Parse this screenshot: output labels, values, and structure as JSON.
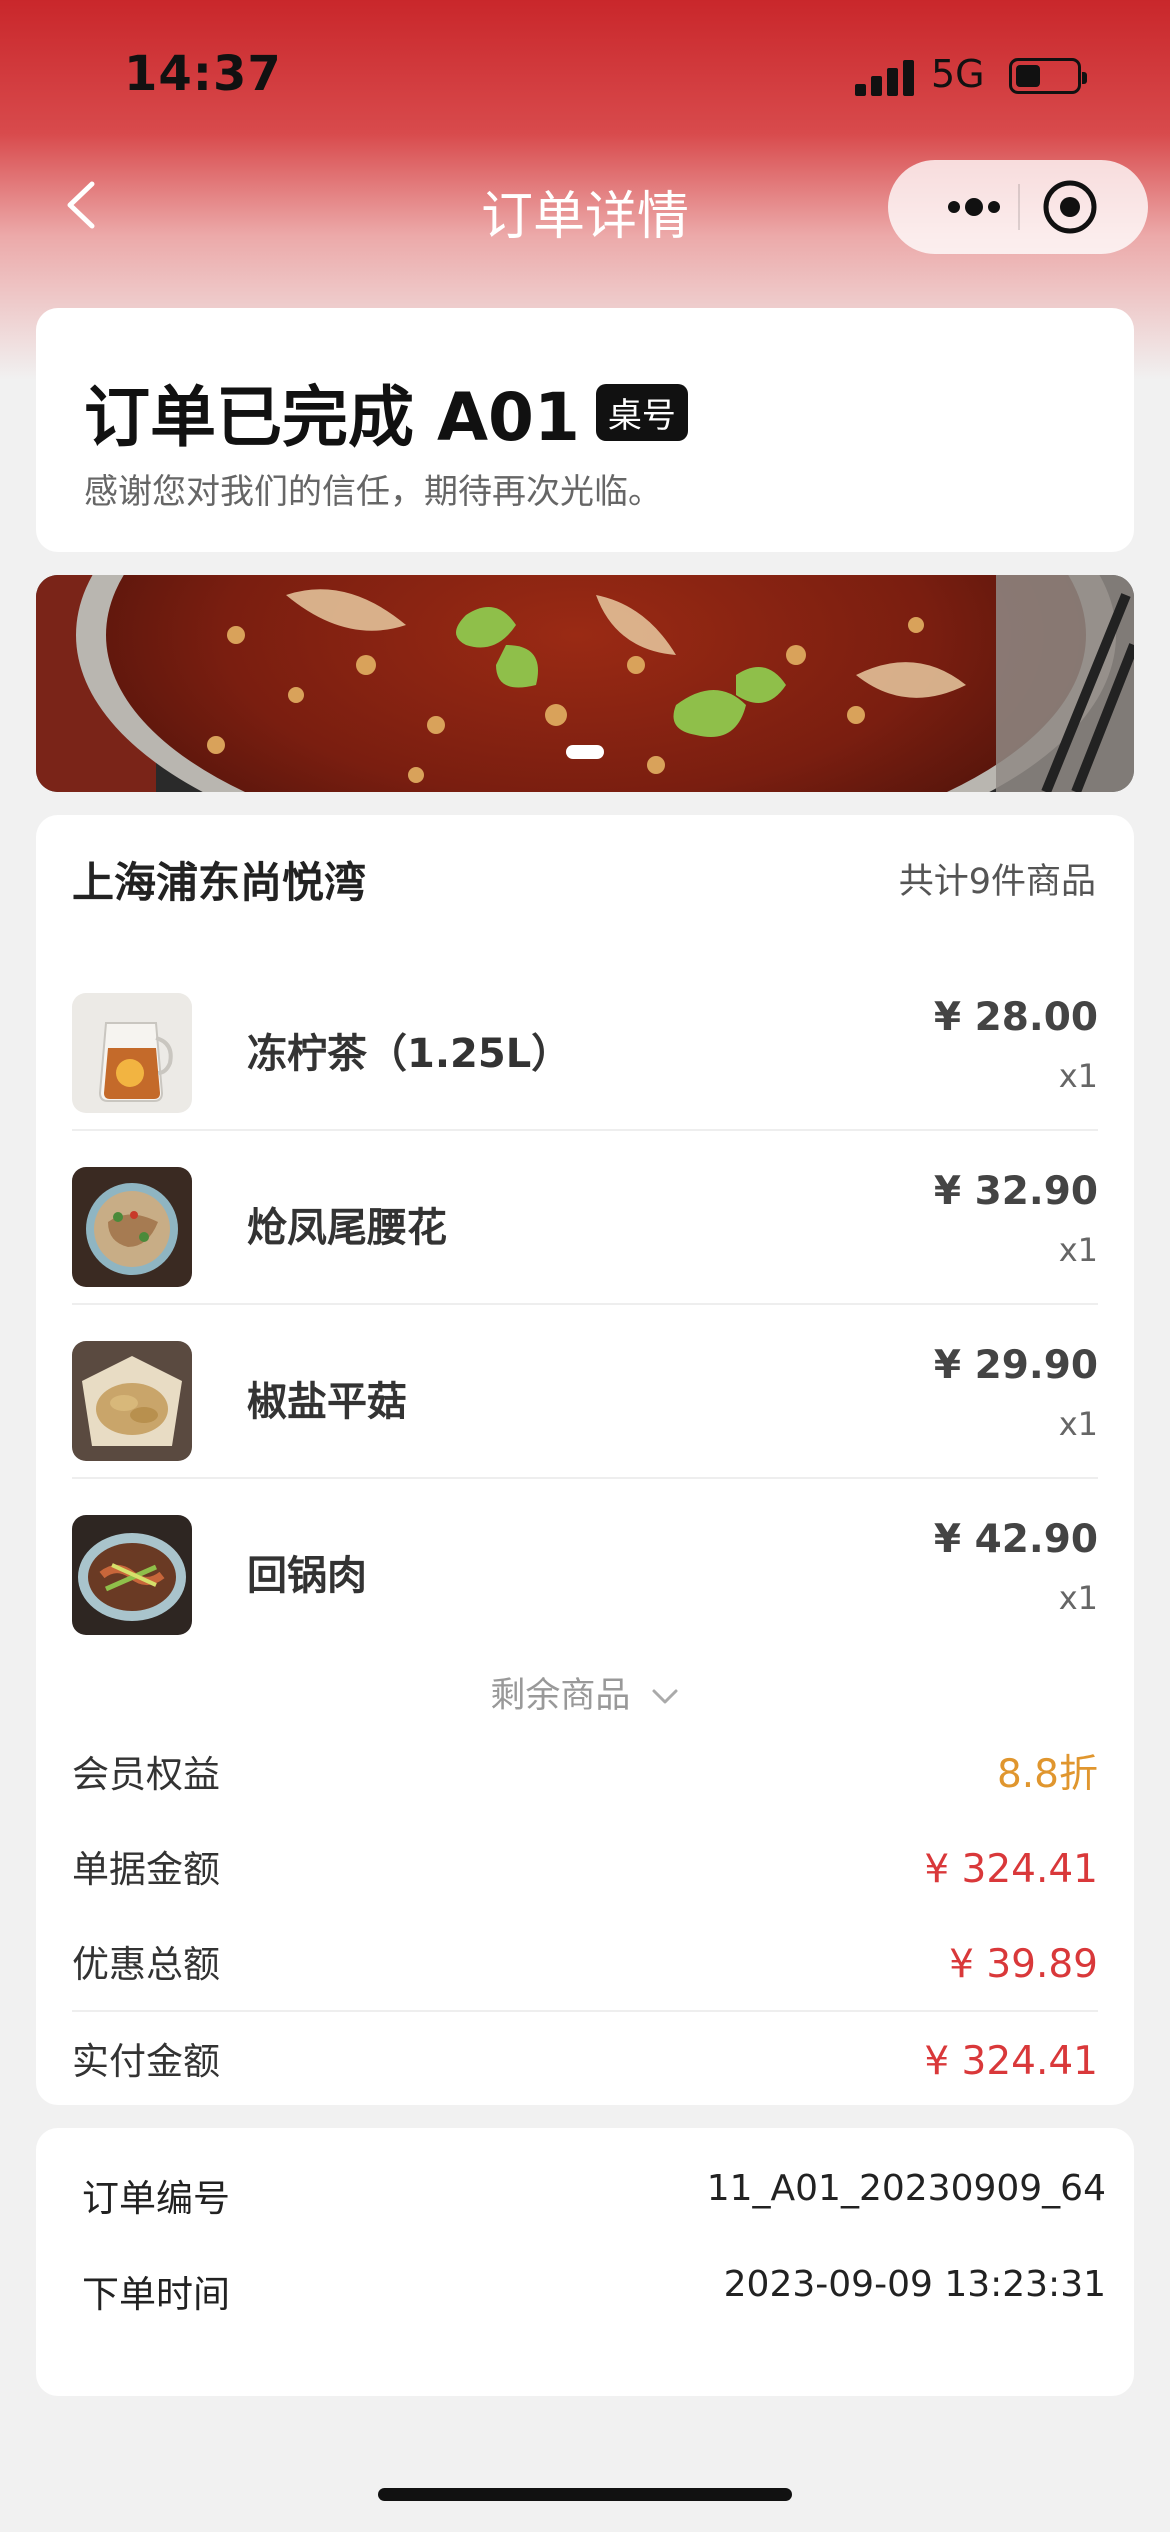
{
  "status_bar": {
    "time": "14:37",
    "network": "5G"
  },
  "nav": {
    "title": "订单详情",
    "icons": [
      "back-icon",
      "more-icon",
      "close-target-icon"
    ]
  },
  "order": {
    "status_title": "订单已完成 A01",
    "table_badge": "桌号",
    "subtitle": "感谢您对我们的信任，期待再次光临。"
  },
  "store": {
    "name": "上海浦东尚悦湾",
    "item_count": "共计9件商品"
  },
  "items": [
    {
      "name": "冻柠茶（1.25L）",
      "price": "¥ 28.00",
      "qty": "x1"
    },
    {
      "name": "炝凤尾腰花",
      "price": "¥ 32.90",
      "qty": "x1"
    },
    {
      "name": "椒盐平菇",
      "price": "¥ 29.90",
      "qty": "x1"
    },
    {
      "name": "回锅肉",
      "price": "¥ 42.90",
      "qty": "x1"
    }
  ],
  "more_items": "剩余商品",
  "summary": [
    {
      "label": "会员权益",
      "value": "8.8折",
      "color": "#e0962e"
    },
    {
      "label": "单据金额",
      "value": "¥ 324.41",
      "color": "#d9383a"
    },
    {
      "label": "优惠总额",
      "value": "¥ 39.89",
      "color": "#d9383a"
    },
    {
      "label": "实付金额",
      "value": "¥ 324.41",
      "color": "#d9383a"
    }
  ],
  "info": [
    {
      "label": "订单编号",
      "value": "11_A01_20230909_64"
    },
    {
      "label": "下单时间",
      "value": "2023-09-09 13:23:31"
    }
  ],
  "colors": {
    "header": "#c9272b",
    "accent_orange": "#e0962e",
    "accent_red": "#d9383a"
  }
}
